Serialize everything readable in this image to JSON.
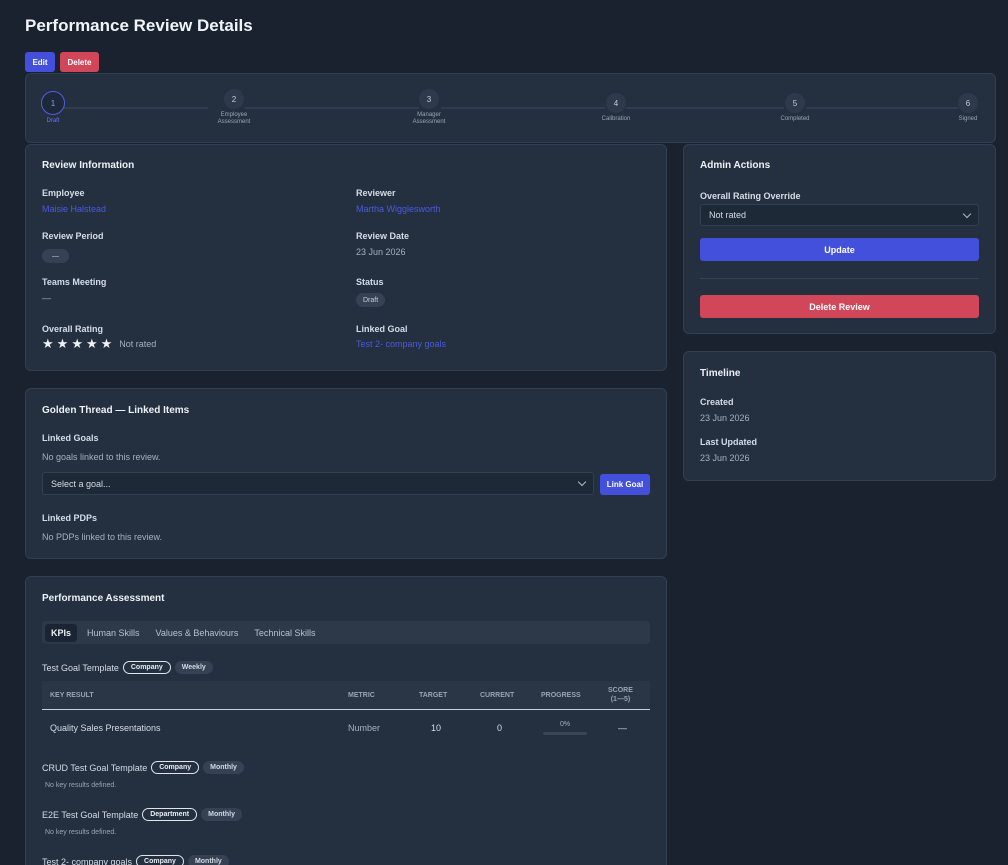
{
  "page": {
    "title": "Performance Review Details"
  },
  "actions": {
    "edit_label": "Edit",
    "delete_label": "Delete"
  },
  "stepper": {
    "steps": [
      {
        "number": "1",
        "label": "Draft",
        "active": true
      },
      {
        "number": "2",
        "label": "Employee\nAssessment"
      },
      {
        "number": "3",
        "label": "Manager\nAssessment"
      },
      {
        "number": "4",
        "label": "Calibration"
      },
      {
        "number": "5",
        "label": "Completed"
      },
      {
        "number": "6",
        "label": "Signed"
      }
    ]
  },
  "review_info": {
    "title": "Review Information",
    "employee_label": "Employee",
    "employee_value": "Maisie Halstead",
    "reviewer_label": "Reviewer",
    "reviewer_value": "Martha Wigglesworth",
    "period_label": "Review Period",
    "period_value": "—",
    "date_label": "Review Date",
    "date_value": "23 Jun 2026",
    "teams_label": "Teams Meeting",
    "teams_value": "—",
    "status_label": "Status",
    "status_value": "Draft",
    "rating_label": "Overall Rating",
    "rating_text": "Not rated",
    "rating_stars": 5,
    "rating_filled": 0,
    "goal_label": "Linked Goal",
    "goal_value": "Test 2- company goals"
  },
  "golden_thread": {
    "title": "Golden Thread — Linked Items",
    "goals_label": "Linked Goals",
    "goals_empty": "No goals linked to this review.",
    "goal_select_placeholder": "Select a goal...",
    "link_button": "Link Goal",
    "pdps_label": "Linked PDPs",
    "pdps_empty": "No PDPs linked to this review."
  },
  "assessment": {
    "title": "Performance Assessment",
    "tabs": [
      {
        "label": "KPIs",
        "active": true
      },
      {
        "label": "Human Skills"
      },
      {
        "label": "Values & Behaviours"
      },
      {
        "label": "Technical Skills"
      }
    ],
    "table_headers": {
      "key_result": "KEY RESULT",
      "metric": "METRIC",
      "target": "TARGET",
      "current": "CURRENT",
      "progress": "PROGRESS",
      "score": "SCORE\n(1—5)"
    },
    "goals": [
      {
        "name": "Test Goal Template",
        "scope": "Company",
        "frequency": "Weekly",
        "rows": [
          {
            "key_result": "Quality Sales Presentations",
            "metric": "Number",
            "target": "10",
            "current": "0",
            "progress_text": "0%",
            "progress": 0,
            "score": "—"
          }
        ]
      },
      {
        "name": "CRUD Test Goal Template",
        "scope": "Company",
        "frequency": "Monthly",
        "note": "No key results defined."
      },
      {
        "name": "E2E Test Goal Template",
        "scope": "Department",
        "frequency": "Monthly",
        "note": "No key results defined."
      },
      {
        "name": "Test 2- company goals",
        "scope": "Company",
        "frequency": "Monthly"
      }
    ]
  },
  "admin": {
    "title": "Admin Actions",
    "override_label": "Overall Rating Override",
    "override_value": "Not rated",
    "update_button": "Update",
    "delete_button": "Delete Review"
  },
  "timeline": {
    "title": "Timeline",
    "created_label": "Created",
    "created_value": "23 Jun 2026",
    "updated_label": "Last Updated",
    "updated_value": "23 Jun 2026"
  },
  "colors": {
    "accent": "#4350dc",
    "danger": "#d14658",
    "link": "#4a5ae0",
    "background": "#1a2230",
    "card": "#243040"
  }
}
